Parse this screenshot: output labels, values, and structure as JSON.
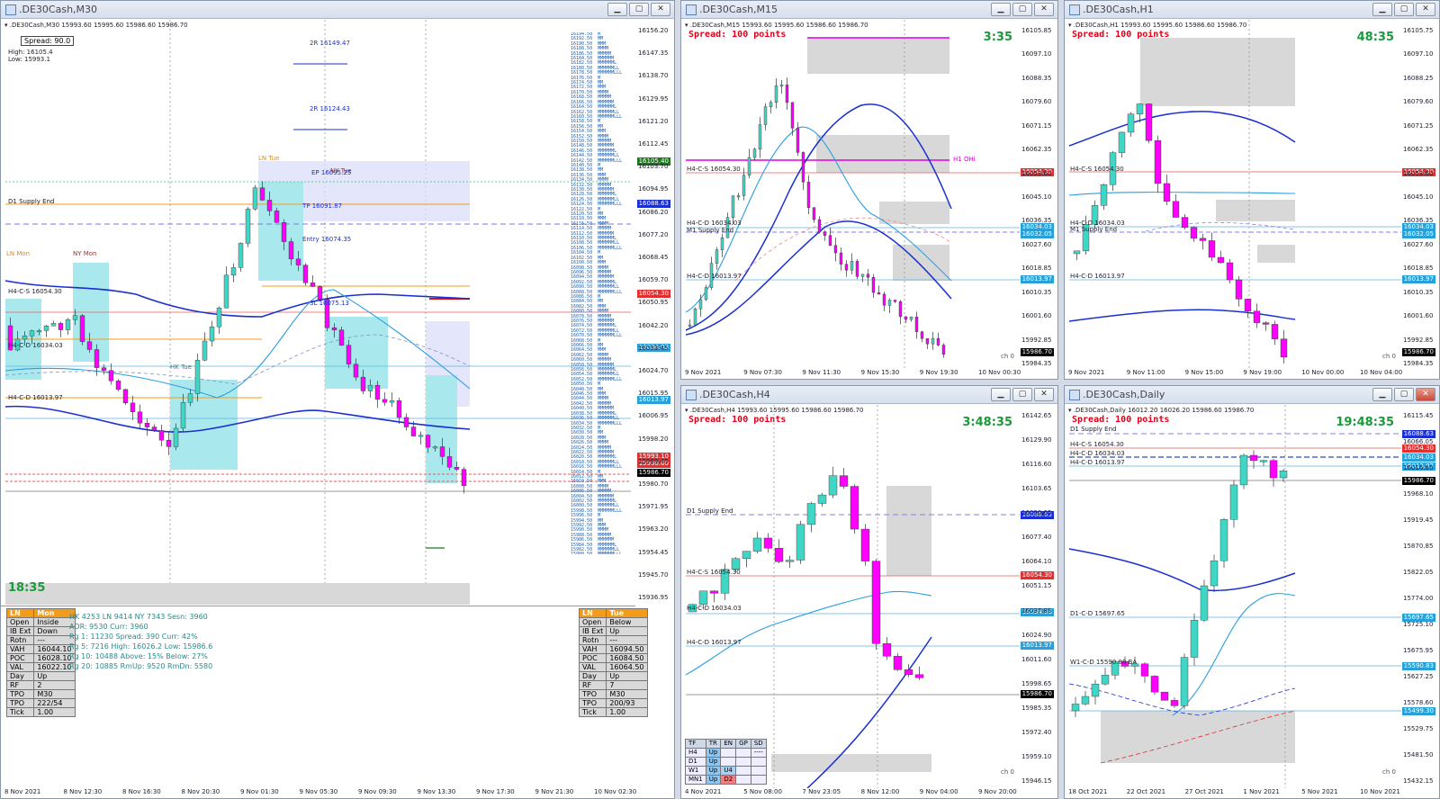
{
  "windows": [
    {
      "id": "m30",
      "title": ".DE30Cash,M30",
      "ohlc": "▾ .DE30Cash,M30  15993.60 15995.60 15986.60 15986.70"
    },
    {
      "id": "m15",
      "title": ".DE30Cash,M15",
      "ohlc": "▾ .DE30Cash,M15  15993.60 15995.60 15986.60 15986.70"
    },
    {
      "id": "h1",
      "title": ".DE30Cash,H1",
      "ohlc": "▾ .DE30Cash,H1  15993.60 15995.60 15986.60 15986.70"
    },
    {
      "id": "h4",
      "title": ".DE30Cash,H4",
      "ohlc": "▾ .DE30Cash,H4  15993.60 15995.60 15986.60 15986.70"
    },
    {
      "id": "daily",
      "title": ".DE30Cash,Daily",
      "ohlc": "▾ .DE30Cash,Daily  16012.20 16026.20 15986.60 15986.70"
    }
  ],
  "m30": {
    "spread_label": "Spread: 90.0",
    "high": "High: 16105.4",
    "low": "Low: 15993.1",
    "timer": "18:35",
    "levels": {
      "r2": "2R 16149.47",
      "r2b": "2R 16124.43",
      "d1_supply": "D1 Supply End",
      "h4cs": "H4-C-S 16054.30",
      "h4cd1": "H4-C-D 16034.03",
      "h4cd2": "H4-C-D 16013.97",
      "nymon": "NY Mon",
      "lntue": "LN Tue",
      "nytue": "NY Tue",
      "lnmon": "LN Mon",
      "hktue": "HK Tue",
      "entry": "Entry 16074.35",
      "sl": "SL 16075.13",
      "ep": "EP 16095.25",
      "tp": "TP 16091.87"
    },
    "price_tags": {
      "p1": "16105.40",
      "p2": "16088.63",
      "p3": "16054.30",
      "p4": "16034.03",
      "p5": "16013.97",
      "p6": "15993.10",
      "p7": "15990.60",
      "p8": "15986.70"
    },
    "y_ticks": [
      "16156.20",
      "16147.35",
      "16138.70",
      "16129.95",
      "16121.20",
      "16112.45",
      "16103.70",
      "16094.95",
      "16086.20",
      "16077.20",
      "16068.45",
      "16059.70",
      "16050.95",
      "16042.20",
      "16033.45",
      "16024.70",
      "16015.95",
      "16006.95",
      "15998.20",
      "15989.45",
      "15980.70",
      "15971.95",
      "15963.20",
      "15954.45",
      "15945.70",
      "15936.95"
    ],
    "x_ticks": [
      "8 Nov 2021",
      "8 Nov 12:30",
      "8 Nov 16:30",
      "8 Nov 20:30",
      "9 Nov 01:30",
      "9 Nov 05:30",
      "9 Nov 09:30",
      "9 Nov 13:30",
      "9 Nov 17:30",
      "9 Nov 21:30",
      "10 Nov 02:30"
    ],
    "session_info": {
      "line1": "HK 4253  LN 9414  NY 7343  Sesn: 3960",
      "line2": "ADR: 9530   Curr: 3960",
      "line3": "Rg 1: 11230  Spread: 390   Curr: 42%",
      "line4": "Rg 5: 7216  High: 16026.2  Low: 15986.6",
      "line5": "Rg 10: 10488  Above: 15%  Below: 27%",
      "line6": "Rg 20: 10885  RmUp: 9520  RmDn: 5580"
    },
    "left_table": {
      "head": [
        "LN",
        "Mon"
      ],
      "rows": [
        [
          "Open",
          "Inside"
        ],
        [
          "IB Ext",
          "Down"
        ],
        [
          "Rotn",
          "---"
        ],
        [
          "VAH",
          "16044.10"
        ],
        [
          "POC",
          "16028.10"
        ],
        [
          "VAL",
          "16022.10"
        ],
        [
          "Day",
          "Up"
        ],
        [
          "RF",
          "2"
        ],
        [
          "TPO",
          "M30"
        ],
        [
          "TPO",
          "222/54"
        ],
        [
          "Tick",
          "1.00"
        ]
      ]
    },
    "right_table": {
      "head": [
        "LN",
        "Tue"
      ],
      "rows": [
        [
          "Open",
          "Below"
        ],
        [
          "IB Ext",
          "Up"
        ],
        [
          "Rotn",
          "---"
        ],
        [
          "VAH",
          "16094.50"
        ],
        [
          "POC",
          "16084.50"
        ],
        [
          "VAL",
          "16064.50"
        ],
        [
          "Day",
          "Up"
        ],
        [
          "RF",
          "7"
        ],
        [
          "TPO",
          "M30"
        ],
        [
          "TPO",
          "200/93"
        ],
        [
          "Tick",
          "1.00"
        ]
      ]
    }
  },
  "m15": {
    "spread": "Spread: 100 points",
    "timer": "3:35",
    "levels": {
      "h1ohi": "H1 OHi",
      "h4cs": "H4-C-S 16054.30",
      "h4cd1": "H4-C-D 16034.03",
      "m1supply": "M1 Supply End",
      "h4cd2": "H4-C-D 16013.97"
    },
    "price_tags": {
      "p1": "16054.30",
      "p2": "16034.03",
      "p3": "16032.05",
      "p4": "16013.97",
      "p5": "15986.70"
    },
    "y_ticks": [
      "16105.85",
      "16097.10",
      "16088.35",
      "16079.60",
      "16071.15",
      "16062.35",
      "16053.60",
      "16045.10",
      "16036.35",
      "16027.60",
      "16018.85",
      "16010.35",
      "16001.60",
      "15992.85",
      "15984.35"
    ],
    "x_ticks": [
      "9 Nov 2021",
      "9 Nov 07:30",
      "9 Nov 11:30",
      "9 Nov 15:30",
      "9 Nov 19:30",
      "10 Nov 00:30"
    ],
    "footer": "ch 0"
  },
  "h1": {
    "spread": "Spread: 100 points",
    "timer": "48:35",
    "levels": {
      "h4cs": "H4-C-S 16054.30",
      "h4cd1": "H4-C-D 16034.03",
      "supply": "M1 Supply End",
      "h4cd2": "H4-C-D 16013.97"
    },
    "price_tags": {
      "p1": "16054.30",
      "p2": "16034.03",
      "p3": "16032.05",
      "p4": "16013.97",
      "p5": "15986.70"
    },
    "y_ticks": [
      "16105.75",
      "16097.10",
      "16088.25",
      "16079.60",
      "16071.25",
      "16062.35",
      "16053.60",
      "16045.10",
      "16036.35",
      "16027.60",
      "16018.85",
      "16010.35",
      "16001.60",
      "15992.85",
      "15984.35"
    ],
    "x_ticks": [
      "9 Nov 2021",
      "9 Nov 11:00",
      "9 Nov 15:00",
      "9 Nov 19:00",
      "10 Nov 00:00",
      "10 Nov 04:00"
    ],
    "footer": "ch 0"
  },
  "h4": {
    "spread": "Spread: 100 points",
    "timer": "3:48:35",
    "levels": {
      "d1supply": "D1 Supply End",
      "h4cs": "H4-C-S 16054.30",
      "h4cd1": "H4-C-D 16034.03",
      "h4cd2": "H4-C-D 16013.97"
    },
    "price_tags": {
      "p1": "16088.63",
      "p2": "16054.30",
      "p3": "16034.03",
      "p4": "16013.97",
      "p5": "15986.70"
    },
    "y_ticks": [
      "16142.65",
      "16129.90",
      "16116.60",
      "16103.65",
      "16090.65",
      "16077.40",
      "16064.10",
      "16051.15",
      "16037.85",
      "16024.90",
      "16011.60",
      "15998.65",
      "15985.35",
      "15972.40",
      "15959.10",
      "15946.15"
    ],
    "x_ticks": [
      "4 Nov 2021",
      "5 Nov 08:00",
      "7 Nov 23:05",
      "8 Nov 12:00",
      "9 Nov 04:00",
      "9 Nov 20:00"
    ],
    "trend_table": {
      "head": [
        "TF",
        "TR",
        "EN",
        "GP",
        "SD"
      ],
      "rows": [
        [
          "H4",
          "Up",
          "",
          "",
          "----"
        ],
        [
          "D1",
          "Up",
          "",
          "",
          ""
        ],
        [
          "W1",
          "Up",
          "U4",
          "",
          ""
        ],
        [
          "MN1",
          "Up",
          "D2",
          "",
          ""
        ]
      ]
    },
    "footer": "ch 0"
  },
  "daily": {
    "spread": "Spread: 100 points",
    "timer": "19:48:35",
    "levels": {
      "d1supply": "D1 Supply End",
      "h4cs": "H4-C-S 16054.30",
      "h4cd1": "H4-C-D 16034.03",
      "h4cd2": "H4-C-D 16013.97",
      "d1cd": "D1-C-D 15697.65",
      "w1cd": "W1-C-D 15590.88 BA"
    },
    "price_tags": {
      "p1": "16088.63",
      "p2": "16054.30",
      "p3": "16034.03",
      "p4": "16013.97",
      "p5": "15986.70",
      "p6": "15697.65",
      "p7": "15590.83",
      "p8": "15499.30"
    },
    "y_ticks": [
      "16115.45",
      "16066.05",
      "16016.85",
      "15968.10",
      "15919.45",
      "15870.85",
      "15822.05",
      "15774.00",
      "15725.10",
      "15675.95",
      "15627.25",
      "15578.60",
      "15529.75",
      "15481.50",
      "15432.15"
    ],
    "x_ticks": [
      "18 Oct 2021",
      "22 Oct 2021",
      "27 Oct 2021",
      "1 Nov 2021",
      "5 Nov 2021",
      "10 Nov 2021"
    ],
    "footer": "ch 0"
  },
  "colors": {
    "bull": "#3fd6c6",
    "bear": "#ff00ff",
    "ma": "#1a2fd1",
    "ma2": "#2a9ee0",
    "supply": "#d8d8d8",
    "resist": "#e83a3a",
    "support": "#2aa0d8",
    "bg": "#ffffff",
    "timer": "#1a9a3a",
    "spread": "#e0001a"
  }
}
